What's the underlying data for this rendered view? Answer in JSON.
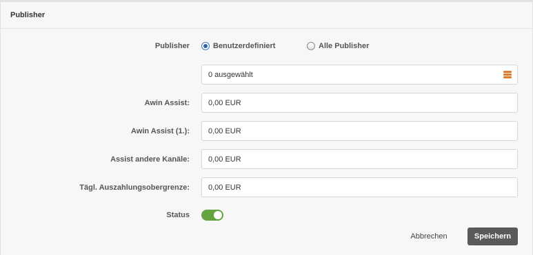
{
  "panel": {
    "title": "Publisher"
  },
  "publisher": {
    "label": "Publisher",
    "options": [
      {
        "label": "Benutzerdefiniert",
        "checked": true
      },
      {
        "label": "Alle Publisher",
        "checked": false
      }
    ]
  },
  "selection": {
    "value": "0 ausgewählt",
    "icon": "list-icon",
    "icon_color": "#e27a2b"
  },
  "fields": [
    {
      "label": "Awin Assist:",
      "value": "0,00 EUR"
    },
    {
      "label": "Awin Assist (1.):",
      "value": "0,00 EUR"
    },
    {
      "label": "Assist andere Kanäle:",
      "value": "0,00 EUR"
    },
    {
      "label": "Tägl. Auszahlungsobergrenze:",
      "value": "0,00 EUR"
    }
  ],
  "status": {
    "label": "Status",
    "enabled": true,
    "color": "#64a440"
  },
  "actions": {
    "cancel_label": "Abbrechen",
    "save_label": "Speichern"
  }
}
